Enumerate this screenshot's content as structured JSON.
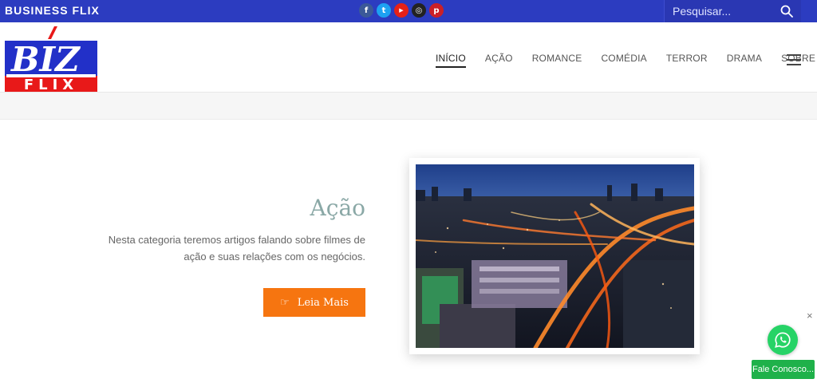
{
  "topbar": {
    "brand": "BUSINESS FLIX",
    "socials": [
      {
        "icon": "facebook-icon",
        "glyph": "f"
      },
      {
        "icon": "twitter-icon",
        "glyph": "t"
      },
      {
        "icon": "youtube-icon",
        "glyph": "▶"
      },
      {
        "icon": "instagram-icon",
        "glyph": "◎"
      },
      {
        "icon": "pinterest-icon",
        "glyph": "p"
      }
    ],
    "search": {
      "placeholder": "Pesquisar..."
    }
  },
  "header": {
    "logo": {
      "top_text": "BIZ",
      "bottom_text": "FLIX"
    },
    "nav": [
      {
        "label": "INÍCIO",
        "active": true
      },
      {
        "label": "AÇÃO"
      },
      {
        "label": "ROMANCE"
      },
      {
        "label": "COMÉDIA"
      },
      {
        "label": "TERROR"
      },
      {
        "label": "DRAMA"
      },
      {
        "label": "SOBRE",
        "has_dropdown": true
      }
    ]
  },
  "main": {
    "title": "Ação",
    "description": "Nesta categoria teremos artigos falando sobre filmes de ação e suas relações com os negócios.",
    "cta_label": "Leia Mais"
  },
  "whatsapp": {
    "close": "×",
    "label": "Fale Conosco..."
  },
  "colors": {
    "topbar": "#2c3cc0",
    "cta": "#f67510",
    "whatsapp": "#26d366",
    "title": "#8aa8a6"
  }
}
